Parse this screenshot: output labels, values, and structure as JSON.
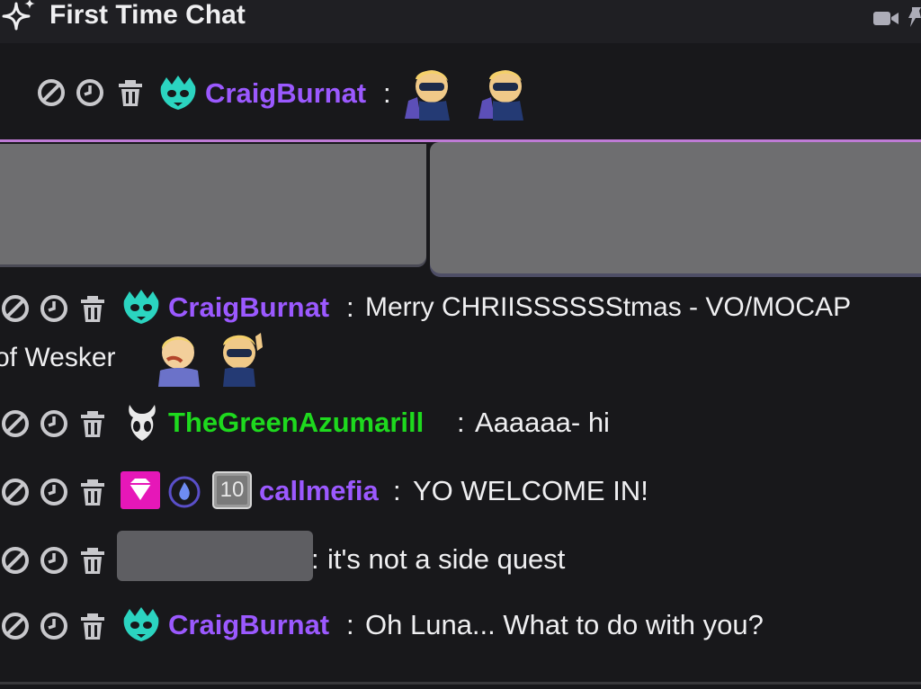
{
  "header": {
    "title": "First Time Chat",
    "title_icon": "sparkle-icon",
    "actions": [
      "camera-icon",
      "pin-icon"
    ]
  },
  "colors": {
    "background": "#18181b",
    "header_bg": "#1f1f23",
    "username_purple": "#9b59ff",
    "username_green": "#1ed91e",
    "pin_line": "#bf7bd6",
    "redaction": "#6e6e70"
  },
  "messages": [
    {
      "username": "CraigBurnat",
      "separator": ":",
      "text": "",
      "badges": [
        "rat-badge-icon"
      ],
      "emotes": [
        "wesker-emote-icon",
        "wesker-emote-icon"
      ]
    },
    {
      "username": "CraigBurnat",
      "separator": ":",
      "text": "Merry CHRIISSSSSStmas - VO/MOCAP",
      "text_line2": "of Wesker",
      "badges": [
        "rat-badge-icon"
      ],
      "emotes": [
        "wesker-emote-icon",
        "wesker-emote-icon"
      ]
    },
    {
      "username": "TheGreenAzumarill",
      "separator": ":",
      "text": "Aaaaaa- hi",
      "badges": [
        "hollow-knight-badge-icon"
      ]
    },
    {
      "username": "callmefia",
      "separator": ":",
      "text": "YO WELCOME IN!",
      "badges": [
        "gem-badge-icon",
        "flame-badge-icon",
        "ten-badge-icon"
      ],
      "ten_badge_text": "10"
    },
    {
      "username": "",
      "separator": ":",
      "text": "it's not a side quest",
      "badges": []
    },
    {
      "username": "CraigBurnat",
      "separator": ":",
      "text": "Oh Luna... What to do with you?",
      "badges": [
        "rat-badge-icon"
      ]
    }
  ],
  "mod_actions": [
    "ban-icon",
    "timeout-icon",
    "delete-icon"
  ]
}
